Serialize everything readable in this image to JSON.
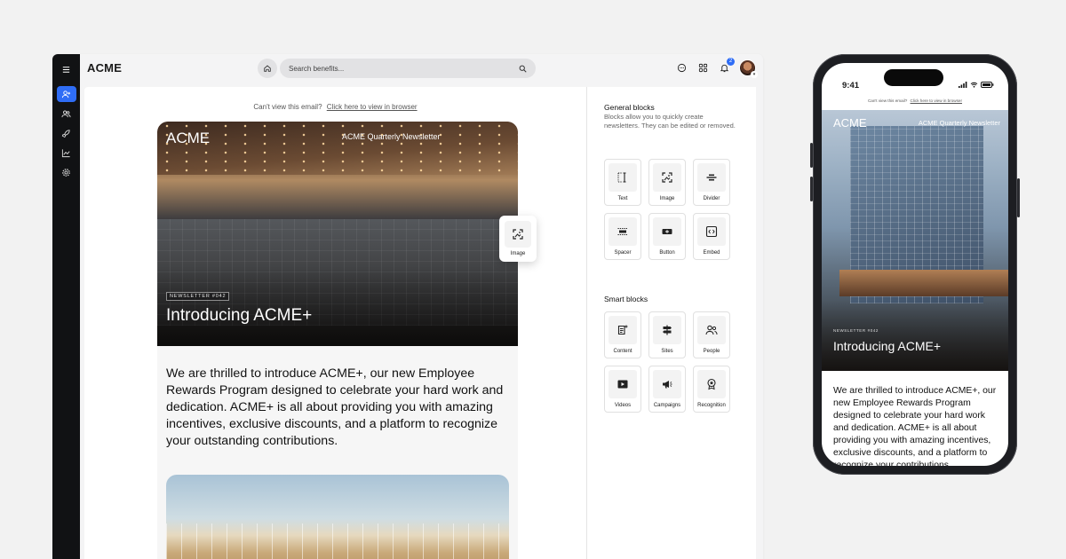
{
  "app": {
    "logo": "ACME",
    "search": {
      "placeholder": "Search benefits..."
    },
    "notifications_count": "2",
    "rail_icons": [
      "menu-icon",
      "add-user-icon",
      "users-icon",
      "rocket-icon",
      "chart-icon",
      "settings-icon"
    ]
  },
  "email": {
    "view_prompt": "Can't view this email?",
    "view_link": "Click here to view in browser",
    "brand": "ACME",
    "newsletter_title": "ACME Quarterly Newsletter",
    "tag": "NEWSLETTER #042",
    "headline": "Introducing ACME+",
    "body": "We are thrilled to introduce ACME+, our new Employee Rewards Program designed to celebrate your hard work and dedication. ACME+ is all about providing you with amazing incentives, exclusive discounts, and a platform to recognize your outstanding contributions."
  },
  "drag_chip": {
    "label": "Image"
  },
  "panel": {
    "general_title": "General blocks",
    "general_desc": "Blocks allow you to quickly create newsletters. They can be edited or removed.",
    "general_blocks": [
      "Text",
      "Image",
      "Divider",
      "Spacer",
      "Button",
      "Embed"
    ],
    "smart_title": "Smart blocks",
    "smart_blocks": [
      "Content",
      "Sites",
      "People",
      "Videos",
      "Campaigns",
      "Recognition"
    ]
  },
  "phone": {
    "time": "9:41",
    "view_prompt": "Can't view this email?",
    "view_link": "Click here to view in browser",
    "brand": "ACME",
    "newsletter_title": "ACME Quarterly Newsletter",
    "tag": "NEWSLETTER #042",
    "headline": "Introducing ACME+",
    "body": "We are thrilled to introduce ACME+, our new Employee Rewards Program designed to celebrate your hard work and dedication. ACME+ is all about providing you with amazing incentives, exclusive discounts, and a platform to recognize your contributions."
  },
  "colors": {
    "accent": "#2f6df6",
    "rail": "#111214"
  }
}
